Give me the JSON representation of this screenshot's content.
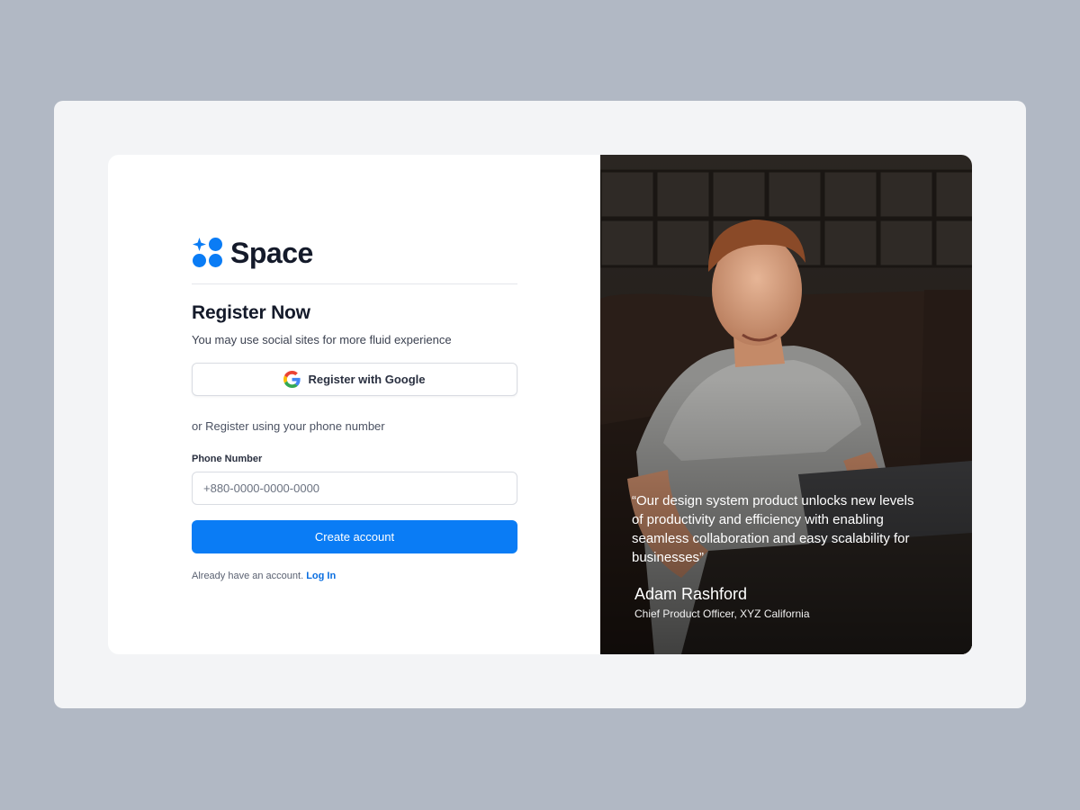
{
  "brand": {
    "name": "Space",
    "logo_icon": "sparkle-dots-logo",
    "accent_color": "#0a7cf5"
  },
  "register": {
    "title": "Register Now",
    "subtitle": "You may use social sites for more fluid experience",
    "google_button_label": "Register with Google",
    "google_icon": "google-g-icon",
    "or_text": "or Register using your phone number",
    "phone_label": "Phone Number",
    "phone_placeholder": "+880-0000-0000-0000",
    "phone_value": "",
    "create_button_label": "Create account",
    "login_prompt": "Already have an account.",
    "login_link": "Log In"
  },
  "testimonial": {
    "quote": "“Our design system product unlocks new levels of productivity and efficiency with enabling seamless collaboration and easy scalability for businesses”",
    "author": "Adam Rashford",
    "role": "Chief Product Officer, XYZ California"
  }
}
